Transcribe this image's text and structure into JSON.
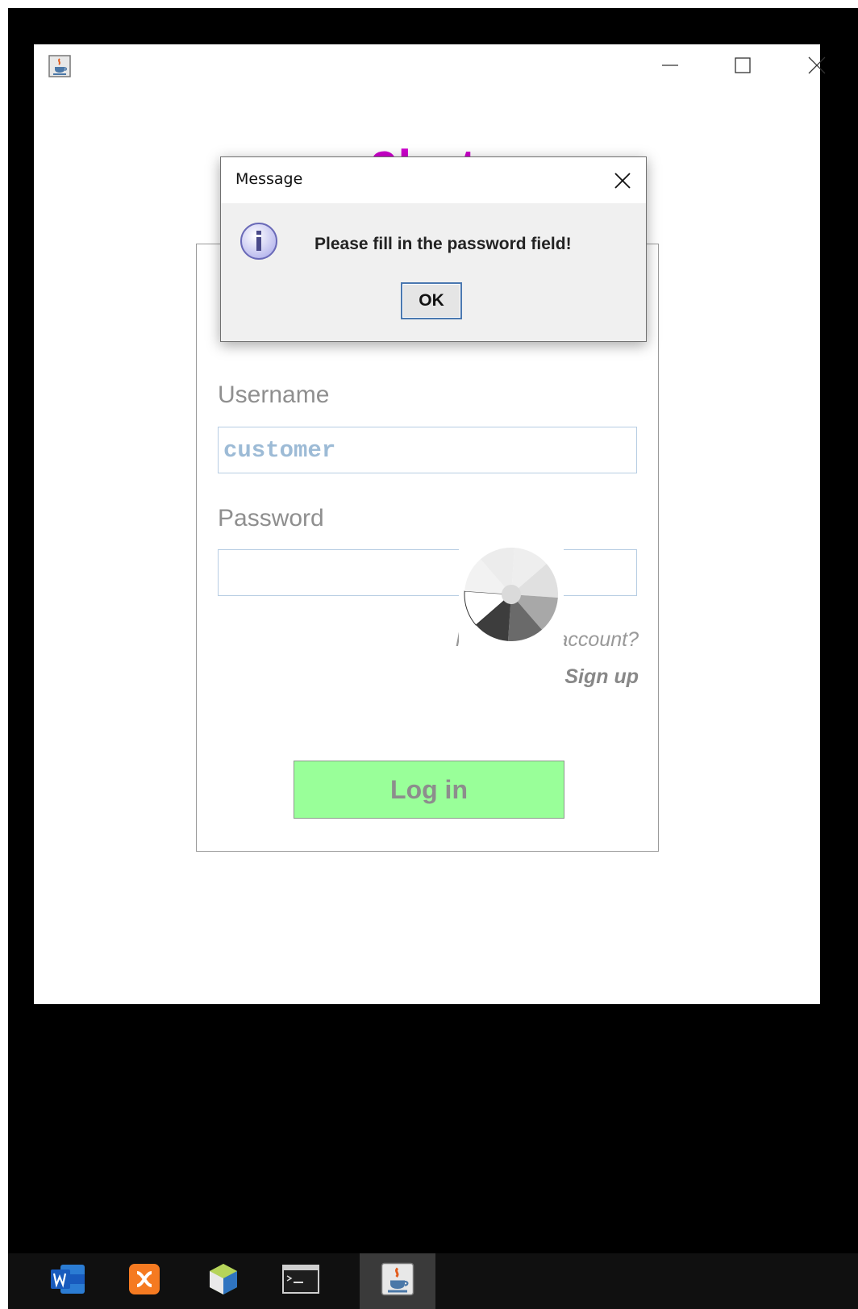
{
  "app": {
    "title": "Chat",
    "title_color": "#cc00cc"
  },
  "login": {
    "username_label": "Username",
    "username_value": "customer",
    "password_label": "Password",
    "password_value": "",
    "account_note": "Haven't an account?",
    "signup_label": "Sign up",
    "login_label": "Log in",
    "login_button_color": "#99ff99"
  },
  "dialog": {
    "title": "Message",
    "message": "Please fill in the password field!",
    "ok_label": "OK",
    "icon": "info-icon"
  },
  "taskbar": {
    "items": [
      {
        "name": "word-icon"
      },
      {
        "name": "xampp-icon"
      },
      {
        "name": "netbeans-icon"
      },
      {
        "name": "terminal-icon"
      },
      {
        "name": "java-icon",
        "active": true
      }
    ]
  }
}
